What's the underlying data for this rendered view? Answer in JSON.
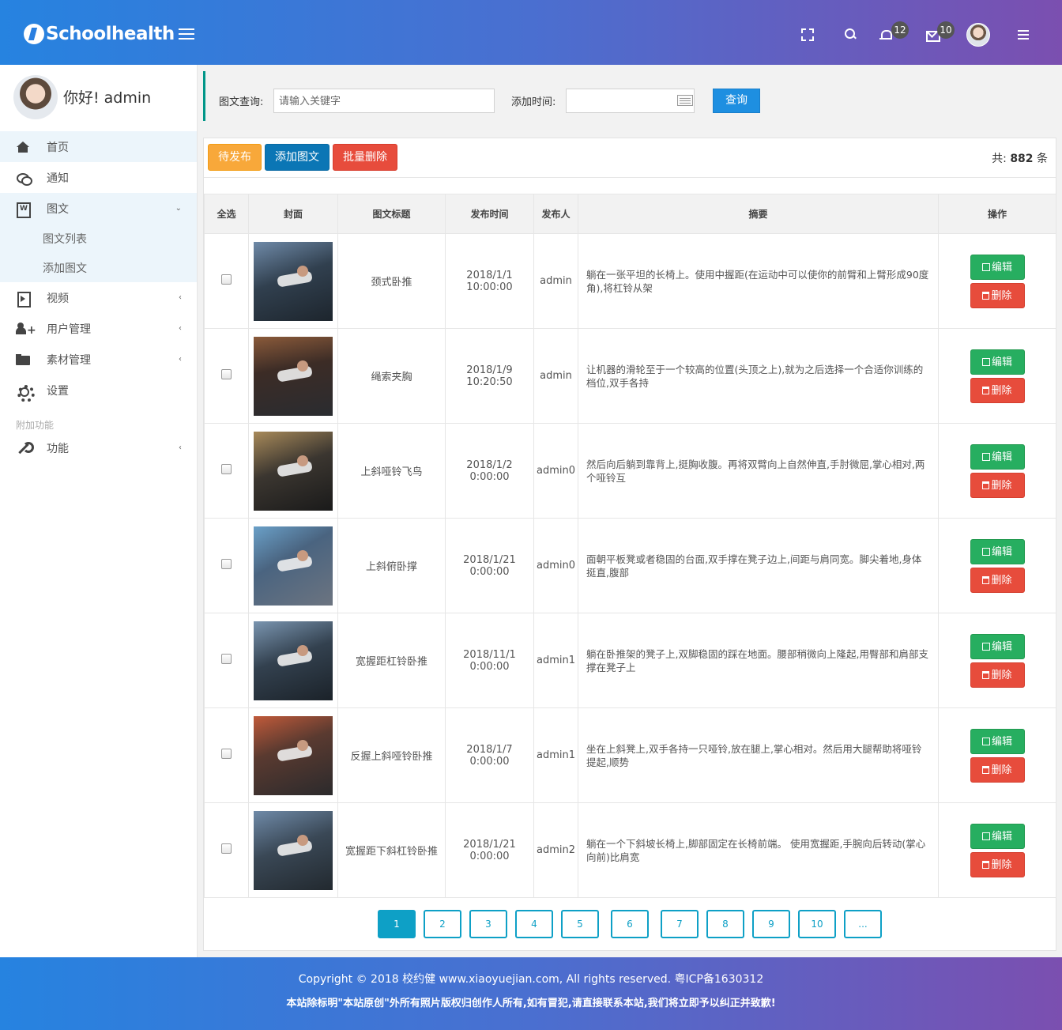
{
  "header": {
    "logo_text": "Schoolhealth",
    "notifications_count": "12",
    "messages_count": "10"
  },
  "sidebar": {
    "greeting": "你好!  admin",
    "items": [
      {
        "label": "首页",
        "icon": "home-icon",
        "active": true
      },
      {
        "label": "通知",
        "icon": "comments-icon"
      },
      {
        "label": "图文",
        "icon": "word-file-icon",
        "expanded": true
      },
      {
        "label": "图文列表",
        "sub": true
      },
      {
        "label": "添加图文",
        "sub": true
      },
      {
        "label": "视频",
        "icon": "video-file-icon"
      },
      {
        "label": "用户管理",
        "icon": "user-add-icon"
      },
      {
        "label": "素材管理",
        "icon": "folder-open-icon"
      },
      {
        "label": "设置",
        "icon": "gear-icon"
      }
    ],
    "section_label": "附加功能",
    "extra_item": {
      "label": "功能",
      "icon": "wrench-icon"
    }
  },
  "search": {
    "keyword_label": "图文查询:",
    "keyword_placeholder": "请输入关键字",
    "date_label": "添加时间:",
    "date_value": "",
    "query_button": "查询"
  },
  "toolbar": {
    "pending_button": "待发布",
    "add_button": "添加图文",
    "batch_delete_button": "批量删除",
    "total_prefix": "共:",
    "total_count": "882",
    "total_suffix": "条"
  },
  "table": {
    "headers": [
      "全选",
      "封面",
      "图文标题",
      "发布时间",
      "发布人",
      "摘要",
      "操作"
    ],
    "edit_label": "编辑",
    "delete_label": "删除",
    "rows": [
      {
        "title": "颈式卧推",
        "time": "2018/1/1 10:00:00",
        "author": "admin",
        "summary": "躺在一张平坦的长椅上。使用中握距(在运动中可以使你的前臂和上臂形成90度角),将杠铃从架"
      },
      {
        "title": "绳索夹胸",
        "time": "2018/1/9 10:20:50",
        "author": "admin",
        "summary": "让机器的滑轮至于一个较高的位置(头顶之上),就为之后选择一个合适你训练的档位,双手各持"
      },
      {
        "title": "上斜哑铃飞鸟",
        "time": "2018/1/2 0:00:00",
        "author": "admin0",
        "summary": "然后向后躺到靠背上,挺胸收腹。再将双臂向上自然伸直,手肘微屈,掌心相对,两个哑铃互"
      },
      {
        "title": "上斜俯卧撑",
        "time": "2018/1/21 0:00:00",
        "author": "admin0",
        "summary": "面朝平板凳或者稳固的台面,双手撑在凳子边上,间距与肩同宽。脚尖着地,身体挺直,腹部"
      },
      {
        "title": "宽握距杠铃卧推",
        "time": "2018/11/1 0:00:00",
        "author": "admin1",
        "summary": "躺在卧推架的凳子上,双脚稳固的踩在地面。腰部稍微向上隆起,用臀部和肩部支撑在凳子上"
      },
      {
        "title": "反握上斜哑铃卧推",
        "time": "2018/1/7 0:00:00",
        "author": "admin1",
        "summary": "坐在上斜凳上,双手各持一只哑铃,放在腿上,掌心相对。然后用大腿帮助将哑铃提起,顺势"
      },
      {
        "title": "宽握距下斜杠铃卧推",
        "time": "2018/1/21 0:00:00",
        "author": "admin2",
        "summary": "躺在一个下斜坡长椅上,脚部固定在长椅前端。 使用宽握距,手腕向后转动(掌心向前)比肩宽"
      }
    ]
  },
  "pagination": [
    "1",
    "2",
    "3",
    "4",
    "5",
    "6",
    "7",
    "8",
    "9",
    "10",
    "..."
  ],
  "footer": {
    "copyright": "Copyright © 2018 校约健 www.xiaoyuejian.com, All rights reserved. 粤ICP备1630312",
    "notice": "本站除标明\"本站原创\"外所有照片版权归创作人所有,如有冒犯,请直接联系本站,我们将立即予以纠正并致歉!"
  },
  "colors": {
    "header_gradient_start": "#2683e0",
    "header_gradient_end": "#7b4fb0",
    "accent_teal": "#009688",
    "edit_green": "#27ae60",
    "delete_red": "#e74c3c",
    "pending_orange": "#f8a83a"
  }
}
